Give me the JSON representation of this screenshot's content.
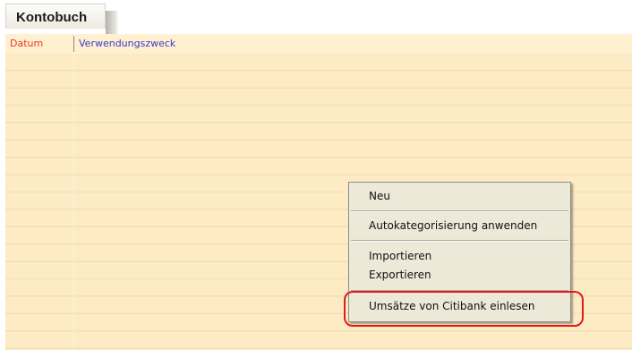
{
  "tab": {
    "title": "Kontobuch"
  },
  "table": {
    "columns": [
      "Datum",
      "Verwendungszweck"
    ]
  },
  "context_menu": {
    "items": {
      "neu": "Neu",
      "autokategorisierung": "Autokategorisierung anwenden",
      "importieren": "Importieren",
      "exportieren": "Exportieren",
      "citibank": "Umsätze von Citibank einlesen"
    }
  },
  "colors": {
    "grid_background": "#fcebc5",
    "datum_header": "#e8362a",
    "zweck_header": "#3b3bcc",
    "highlight_outline": "#e41b1b"
  }
}
